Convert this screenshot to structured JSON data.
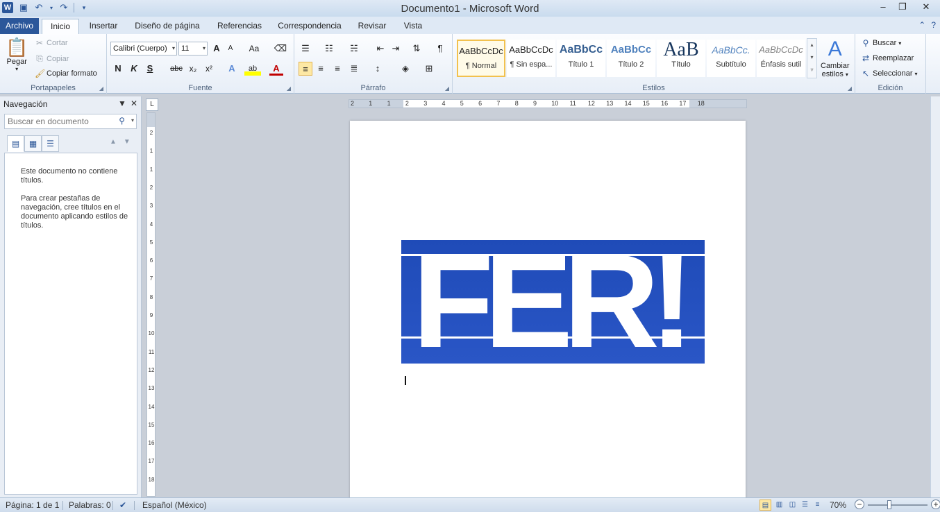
{
  "window": {
    "title": "Documento1 - Microsoft Word",
    "controls": [
      "‒",
      "❐",
      "✕"
    ]
  },
  "qat": {
    "icons": [
      "save-icon",
      "undo-icon",
      "redo-icon",
      "customize-icon"
    ]
  },
  "tabs": [
    {
      "label": "Archivo"
    },
    {
      "label": "Inicio"
    },
    {
      "label": "Insertar"
    },
    {
      "label": "Diseño de página"
    },
    {
      "label": "Referencias"
    },
    {
      "label": "Correspondencia"
    },
    {
      "label": "Revisar"
    },
    {
      "label": "Vista"
    }
  ],
  "ribbon": {
    "clipboard": {
      "paste": "Pegar",
      "cut": "Cortar",
      "copy": "Copiar",
      "format_painter": "Copiar formato",
      "label": "Portapapeles"
    },
    "font": {
      "name": "Calibri (Cuerpo)",
      "size": "11",
      "label": "Fuente",
      "bold": "N",
      "italic": "K",
      "underline": "S",
      "strike": "abc",
      "sub": "x₂",
      "sup": "x²",
      "case": "Aa",
      "grow": "A",
      "shrink": "A",
      "highlight": "ab",
      "color": "A"
    },
    "paragraph": {
      "label": "Párrafo",
      "pilcrow": "¶"
    },
    "styles": {
      "label": "Estilos",
      "items": [
        {
          "sample": "AaBbCcDc",
          "label": "¶ Normal"
        },
        {
          "sample": "AaBbCcDc",
          "label": "¶ Sin espa..."
        },
        {
          "sample": "AaBbCc",
          "label": "Título 1"
        },
        {
          "sample": "AaBbCc",
          "label": "Título 2"
        },
        {
          "sample": "AaB",
          "label": "Título"
        },
        {
          "sample": "AaBbCc.",
          "label": "Subtítulo"
        },
        {
          "sample": "AaBbCcDc",
          "label": "Énfasis sutil"
        }
      ],
      "change_line1": "Cambiar",
      "change_line2": "estilos"
    },
    "editing": {
      "label": "Edición",
      "find": "Buscar",
      "replace": "Reemplazar",
      "select": "Seleccionar"
    }
  },
  "nav": {
    "title": "Navegación",
    "search_placeholder": "Buscar en documento",
    "msg1": "Este documento no contiene títulos.",
    "msg2": "Para crear pestañas de navegación, cree títulos en el documento aplicando estilos de títulos."
  },
  "ruler": {
    "h_ticks": [
      "2",
      "1",
      "1",
      "2",
      "3",
      "4",
      "5",
      "6",
      "7",
      "8",
      "9",
      "10",
      "11",
      "12",
      "13",
      "14",
      "15",
      "16",
      "17",
      "18"
    ],
    "v_ticks": [
      "2",
      "1",
      "1",
      "2",
      "3",
      "4",
      "5",
      "6",
      "7",
      "8",
      "9",
      "10",
      "11",
      "12",
      "13",
      "14",
      "15",
      "16",
      "17",
      "18"
    ]
  },
  "document": {
    "logo_text": "FER!"
  },
  "status": {
    "page": "Página: 1 de 1",
    "words": "Palabras: 0",
    "language": "Español (México)",
    "zoom": "70%"
  },
  "colors": {
    "brand": "#2b579a",
    "logo_blue": "#2352c0"
  }
}
